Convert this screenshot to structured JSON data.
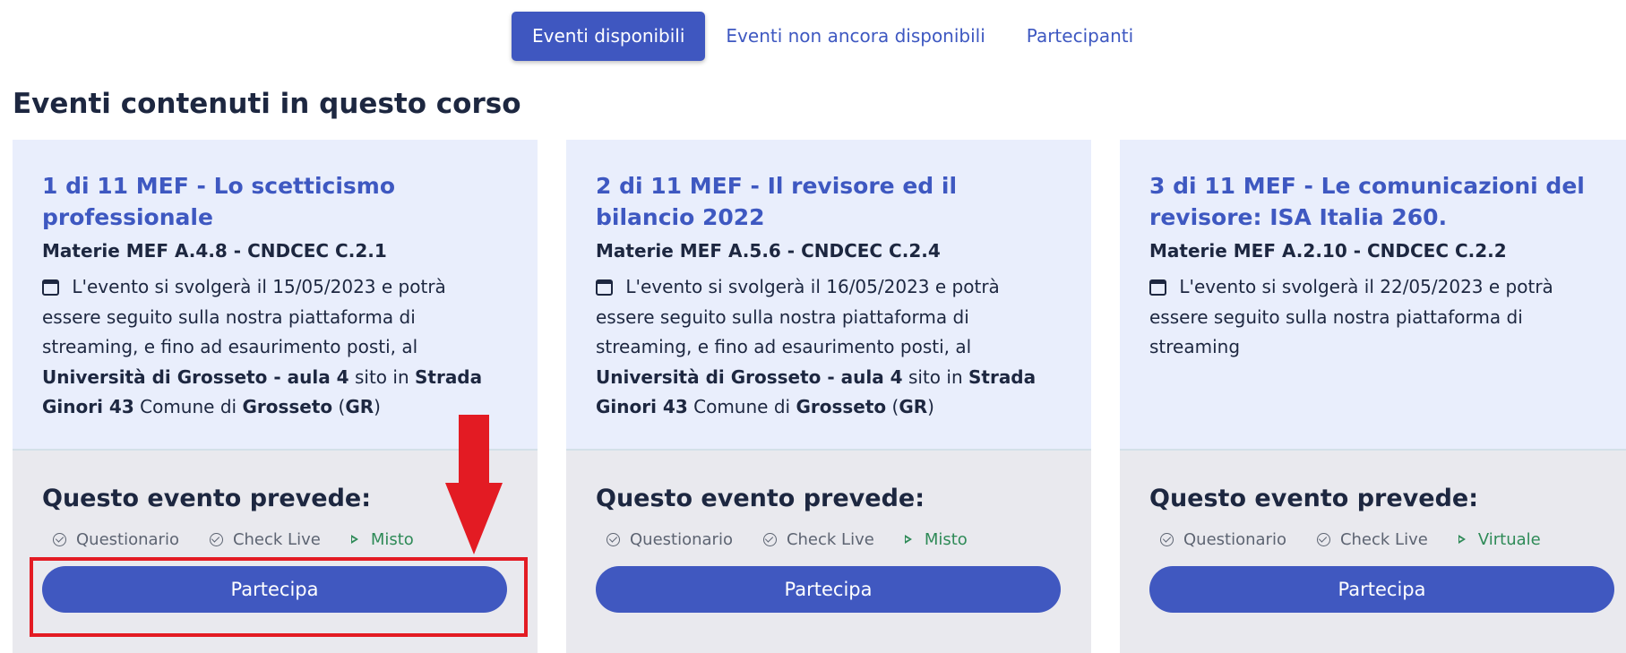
{
  "tabs": [
    {
      "label": "Eventi disponibili",
      "active": true
    },
    {
      "label": "Eventi non ancora disponibili",
      "active": false
    },
    {
      "label": "Partecipanti",
      "active": false
    }
  ],
  "section_title": "Eventi contenuti in questo corso",
  "colors": {
    "accent": "#3f57c0",
    "card_top_bg": "#e9eefc",
    "card_bottom_bg": "#e9e9ee",
    "mode_green": "#2e8a57",
    "annotation_red": "#e31b23"
  },
  "cards": [
    {
      "title": "1 di 11 MEF - Lo scetticismo professionale",
      "subject": "Materie MEF A.4.8 - CNDCEC C.2.1",
      "desc_intro": "L'evento si svolgerà il 15/05/2023 e potrà essere seguito sulla nostra piattaforma di streaming, e fino ad esaurimento posti, al",
      "venue": "Università di Grosseto - aula 4",
      "sito_in": "sito in",
      "street": "Strada Ginori 43",
      "comune_di": "Comune di",
      "city": "Grosseto",
      "province": "GR",
      "prevede": "Questo evento prevede:",
      "features": [
        "Questionario",
        "Check Live"
      ],
      "mode": "Misto",
      "button": "Partecipa"
    },
    {
      "title": "2 di 11 MEF - Il revisore ed il bilancio 2022",
      "subject": "Materie MEF A.5.6 - CNDCEC C.2.4",
      "desc_intro": "L'evento si svolgerà il 16/05/2023 e potrà essere seguito sulla nostra piattaforma di streaming, e fino ad esaurimento posti, al",
      "venue": "Università di Grosseto - aula 4",
      "sito_in": "sito in",
      "street": "Strada Ginori 43",
      "comune_di": "Comune di",
      "city": "Grosseto",
      "province": "GR",
      "prevede": "Questo evento prevede:",
      "features": [
        "Questionario",
        "Check Live"
      ],
      "mode": "Misto",
      "button": "Partecipa"
    },
    {
      "title": "3 di 11 MEF - Le comunicazioni del revisore: ISA Italia 260.",
      "subject": "Materie MEF A.2.10 - CNDCEC C.2.2",
      "desc_intro": "L'evento si svolgerà il 22/05/2023 e potrà essere seguito sulla nostra piattaforma di streaming",
      "prevede": "Questo evento prevede:",
      "features": [
        "Questionario",
        "Check Live"
      ],
      "mode": "Virtuale",
      "button": "Partecipa"
    }
  ]
}
